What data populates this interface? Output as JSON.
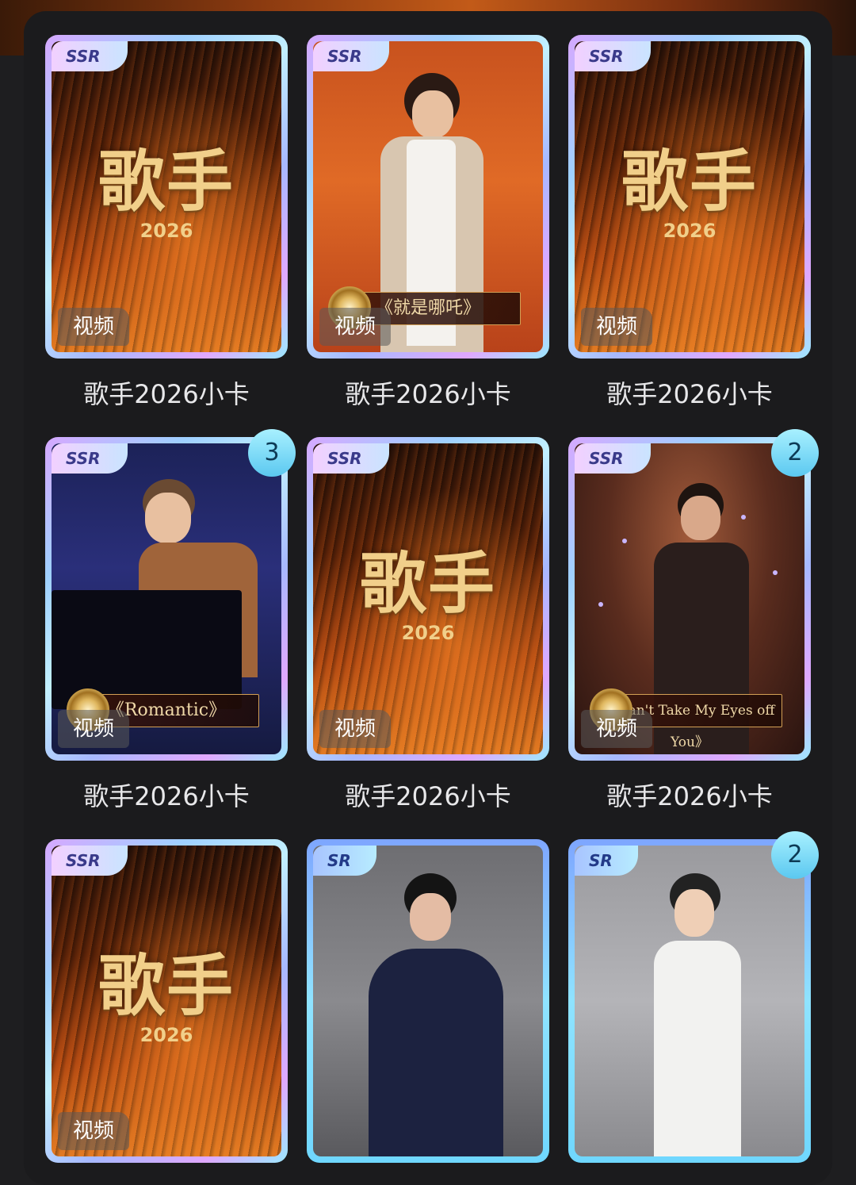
{
  "cards": [
    {
      "rarity": "SSR",
      "media": "视频",
      "caption": "歌手2026小卡",
      "logo_title": "歌手",
      "logo_year": "2026",
      "song": "",
      "badge": ""
    },
    {
      "rarity": "SSR",
      "media": "视频",
      "caption": "歌手2026小卡",
      "logo_title": "",
      "logo_year": "",
      "song": "《就是哪吒》",
      "badge": ""
    },
    {
      "rarity": "SSR",
      "media": "视频",
      "caption": "歌手2026小卡",
      "logo_title": "歌手",
      "logo_year": "2026",
      "song": "",
      "badge": ""
    },
    {
      "rarity": "SSR",
      "media": "视频",
      "caption": "歌手2026小卡",
      "logo_title": "",
      "logo_year": "",
      "song": "《Romantic》",
      "badge": "3"
    },
    {
      "rarity": "SSR",
      "media": "视频",
      "caption": "歌手2026小卡",
      "logo_title": "歌手",
      "logo_year": "2026",
      "song": "",
      "badge": ""
    },
    {
      "rarity": "SSR",
      "media": "视频",
      "caption": "歌手2026小卡",
      "logo_title": "",
      "logo_year": "",
      "song": "《Can't Take My Eyes off You》",
      "badge": "2"
    },
    {
      "rarity": "SSR",
      "media": "视频",
      "caption": "",
      "logo_title": "歌手",
      "logo_year": "2026",
      "song": "",
      "badge": ""
    },
    {
      "rarity": "SR",
      "media": "",
      "caption": "",
      "logo_title": "",
      "logo_year": "",
      "song": "",
      "badge": ""
    },
    {
      "rarity": "SR",
      "media": "",
      "caption": "",
      "logo_title": "",
      "logo_year": "",
      "song": "",
      "badge": "2"
    }
  ],
  "colors": {
    "background": "#1e1e20",
    "ssr_frame": "#c2f0ff",
    "sr_frame": "#8fe3ff",
    "badge": "#5bc8f0",
    "caption_text": "#e8e8ea"
  }
}
